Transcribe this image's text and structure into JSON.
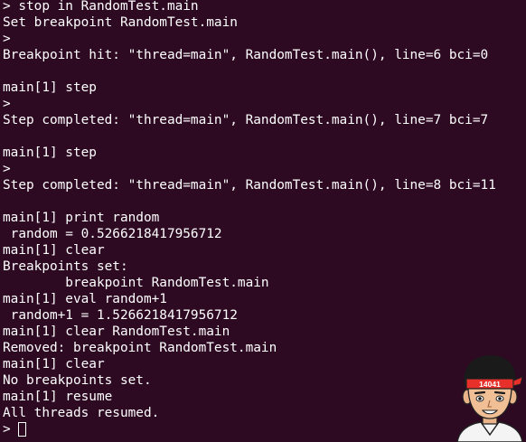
{
  "terminal": {
    "lines": [
      "> stop in RandomTest.main",
      "Set breakpoint RandomTest.main",
      ">",
      "Breakpoint hit: \"thread=main\", RandomTest.main(), line=6 bci=0",
      "",
      "main[1] step",
      ">",
      "Step completed: \"thread=main\", RandomTest.main(), line=7 bci=7",
      "",
      "main[1] step",
      ">",
      "Step completed: \"thread=main\", RandomTest.main(), line=8 bci=11",
      "",
      "main[1] print random",
      " random = 0.5266218417956712",
      "main[1] clear",
      "Breakpoints set:",
      "        breakpoint RandomTest.main",
      "main[1] eval random+1",
      " random+1 = 1.5266218417956712",
      "main[1] clear RandomTest.main",
      "Removed: breakpoint RandomTest.main",
      "main[1] clear",
      "No breakpoints set.",
      "main[1] resume",
      "All threads resumed."
    ],
    "prompt": "> "
  },
  "watermark": {
    "headband_text": "14041"
  },
  "colors": {
    "background": "#2d0922",
    "foreground": "#ffffff",
    "headband": "#e8302a"
  }
}
